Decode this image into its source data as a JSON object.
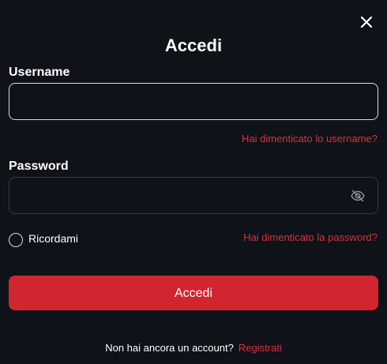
{
  "dialog": {
    "title": "Accedi",
    "close_icon": "close-icon"
  },
  "username": {
    "label": "Username",
    "value": "",
    "placeholder": "",
    "forgot_link": "Hai dimenticato lo username?"
  },
  "password": {
    "label": "Password",
    "value": "",
    "placeholder": "",
    "visibility_icon": "eye-off-icon",
    "forgot_link": "Hai dimenticato la password?"
  },
  "remember_me": {
    "label": "Ricordami",
    "checked": false
  },
  "submit": {
    "label": "Accedi"
  },
  "signup": {
    "text": "Non hai ancora un account?",
    "link": "Registrati"
  },
  "colors": {
    "background": "#0f1218",
    "accent": "#d12630",
    "link": "#d5333d",
    "input_border_focused": "#d9dde3",
    "input_border": "#363b44"
  }
}
